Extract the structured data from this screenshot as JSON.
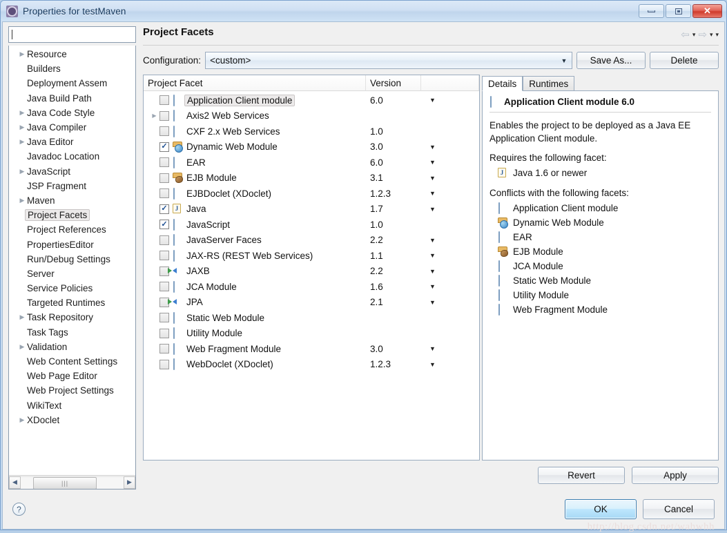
{
  "window": {
    "title": "Properties for testMaven",
    "app_icon": "gear-icon",
    "minimize_label": "Minimize",
    "maximize_label": "Maximize",
    "close_label": "✕"
  },
  "sidebar": {
    "filter": {
      "value": "",
      "placeholder": ""
    },
    "items": [
      {
        "label": "Resource",
        "expandable": true,
        "selected": false
      },
      {
        "label": "Builders",
        "expandable": false,
        "selected": false
      },
      {
        "label": "Deployment Assem",
        "expandable": false,
        "selected": false
      },
      {
        "label": "Java Build Path",
        "expandable": false,
        "selected": false
      },
      {
        "label": "Java Code Style",
        "expandable": true,
        "selected": false
      },
      {
        "label": "Java Compiler",
        "expandable": true,
        "selected": false
      },
      {
        "label": "Java Editor",
        "expandable": true,
        "selected": false
      },
      {
        "label": "Javadoc Location",
        "expandable": false,
        "selected": false
      },
      {
        "label": "JavaScript",
        "expandable": true,
        "selected": false
      },
      {
        "label": "JSP Fragment",
        "expandable": false,
        "selected": false
      },
      {
        "label": "Maven",
        "expandable": true,
        "selected": false
      },
      {
        "label": "Project Facets",
        "expandable": false,
        "selected": true
      },
      {
        "label": "Project References",
        "expandable": false,
        "selected": false
      },
      {
        "label": "PropertiesEditor",
        "expandable": false,
        "selected": false
      },
      {
        "label": "Run/Debug Settings",
        "expandable": false,
        "selected": false
      },
      {
        "label": "Server",
        "expandable": false,
        "selected": false
      },
      {
        "label": "Service Policies",
        "expandable": false,
        "selected": false
      },
      {
        "label": "Targeted Runtimes",
        "expandable": false,
        "selected": false
      },
      {
        "label": "Task Repository",
        "expandable": true,
        "selected": false
      },
      {
        "label": "Task Tags",
        "expandable": false,
        "selected": false
      },
      {
        "label": "Validation",
        "expandable": true,
        "selected": false
      },
      {
        "label": "Web Content Settings",
        "expandable": false,
        "selected": false
      },
      {
        "label": "Web Page Editor",
        "expandable": false,
        "selected": false
      },
      {
        "label": "Web Project Settings",
        "expandable": false,
        "selected": false
      },
      {
        "label": "WikiText",
        "expandable": false,
        "selected": false
      },
      {
        "label": "XDoclet",
        "expandable": true,
        "selected": false
      }
    ]
  },
  "page": {
    "title": "Project Facets",
    "nav": {
      "back": "⇦",
      "forward": "⇨",
      "caret": "▾"
    }
  },
  "configuration": {
    "label": "Configuration:",
    "value": "<custom>",
    "arrow": "▼",
    "save_as_label": "Save As...",
    "delete_label": "Delete"
  },
  "facets_table": {
    "columns": [
      "Project Facet",
      "Version",
      ""
    ],
    "rows": [
      {
        "name": "Application Client module",
        "version": "6.0",
        "checked": false,
        "has_version_menu": true,
        "icon": "doc-icon",
        "expandable": false,
        "selected": true
      },
      {
        "name": "Axis2 Web Services",
        "version": "",
        "checked": false,
        "has_version_menu": false,
        "icon": "doc-icon",
        "expandable": true,
        "selected": false
      },
      {
        "name": "CXF 2.x Web Services",
        "version": "1.0",
        "checked": false,
        "has_version_menu": false,
        "icon": "doc-icon",
        "expandable": false,
        "selected": false
      },
      {
        "name": "Dynamic Web Module",
        "version": "3.0",
        "checked": true,
        "has_version_menu": true,
        "icon": "globe-icon",
        "expandable": false,
        "selected": false
      },
      {
        "name": "EAR",
        "version": "6.0",
        "checked": false,
        "has_version_menu": true,
        "icon": "doc-icon",
        "expandable": false,
        "selected": false
      },
      {
        "name": "EJB Module",
        "version": "3.1",
        "checked": false,
        "has_version_menu": true,
        "icon": "bean-icon",
        "expandable": false,
        "selected": false
      },
      {
        "name": "EJBDoclet (XDoclet)",
        "version": "1.2.3",
        "checked": false,
        "has_version_menu": true,
        "icon": "doc-icon",
        "expandable": false,
        "selected": false
      },
      {
        "name": "Java",
        "version": "1.7",
        "checked": true,
        "has_version_menu": true,
        "icon": "java-icon",
        "expandable": false,
        "selected": false
      },
      {
        "name": "JavaScript",
        "version": "1.0",
        "checked": true,
        "has_version_menu": false,
        "icon": "doc-icon",
        "expandable": false,
        "selected": false
      },
      {
        "name": "JavaServer Faces",
        "version": "2.2",
        "checked": false,
        "has_version_menu": true,
        "icon": "doc-icon",
        "expandable": false,
        "selected": false
      },
      {
        "name": "JAX-RS (REST Web Services)",
        "version": "1.1",
        "checked": false,
        "has_version_menu": true,
        "icon": "doc-icon",
        "expandable": false,
        "selected": false
      },
      {
        "name": "JAXB",
        "version": "2.2",
        "checked": false,
        "has_version_menu": true,
        "icon": "xml-icon",
        "expandable": false,
        "selected": false
      },
      {
        "name": "JCA Module",
        "version": "1.6",
        "checked": false,
        "has_version_menu": true,
        "icon": "doc-icon",
        "expandable": false,
        "selected": false
      },
      {
        "name": "JPA",
        "version": "2.1",
        "checked": false,
        "has_version_menu": true,
        "icon": "xml-icon",
        "expandable": false,
        "selected": false
      },
      {
        "name": "Static Web Module",
        "version": "",
        "checked": false,
        "has_version_menu": false,
        "icon": "doc-icon",
        "expandable": false,
        "selected": false
      },
      {
        "name": "Utility Module",
        "version": "",
        "checked": false,
        "has_version_menu": false,
        "icon": "doc-icon",
        "expandable": false,
        "selected": false
      },
      {
        "name": "Web Fragment Module",
        "version": "3.0",
        "checked": false,
        "has_version_menu": true,
        "icon": "doc-icon",
        "expandable": false,
        "selected": false
      },
      {
        "name": "WebDoclet (XDoclet)",
        "version": "1.2.3",
        "checked": false,
        "has_version_menu": true,
        "icon": "doc-icon",
        "expandable": false,
        "selected": false
      }
    ]
  },
  "details": {
    "tabs": [
      {
        "label": "Details",
        "active": true
      },
      {
        "label": "Runtimes",
        "active": false
      }
    ],
    "heading": "Application Client module 6.0",
    "heading_icon": "doc-icon",
    "description": "Enables the project to be deployed as a Java EE Application Client module.",
    "requires_label": "Requires the following facet:",
    "requires": [
      {
        "label": "Java 1.6 or newer",
        "icon": "java-icon"
      }
    ],
    "conflicts_label": "Conflicts with the following facets:",
    "conflicts": [
      {
        "label": "Application Client module",
        "icon": "doc-icon"
      },
      {
        "label": "Dynamic Web Module",
        "icon": "globe-icon"
      },
      {
        "label": "EAR",
        "icon": "doc-icon"
      },
      {
        "label": "EJB Module",
        "icon": "bean-icon"
      },
      {
        "label": "JCA Module",
        "icon": "doc-icon"
      },
      {
        "label": "Static Web Module",
        "icon": "doc-icon"
      },
      {
        "label": "Utility Module",
        "icon": "doc-icon"
      },
      {
        "label": "Web Fragment Module",
        "icon": "doc-icon"
      }
    ]
  },
  "pane_footer": {
    "revert_label": "Revert",
    "apply_label": "Apply"
  },
  "bottom_bar": {
    "help_glyph": "?",
    "ok_label": "OK",
    "cancel_label": "Cancel",
    "watermark": "http://blog.csdn.net/wahwhh"
  }
}
